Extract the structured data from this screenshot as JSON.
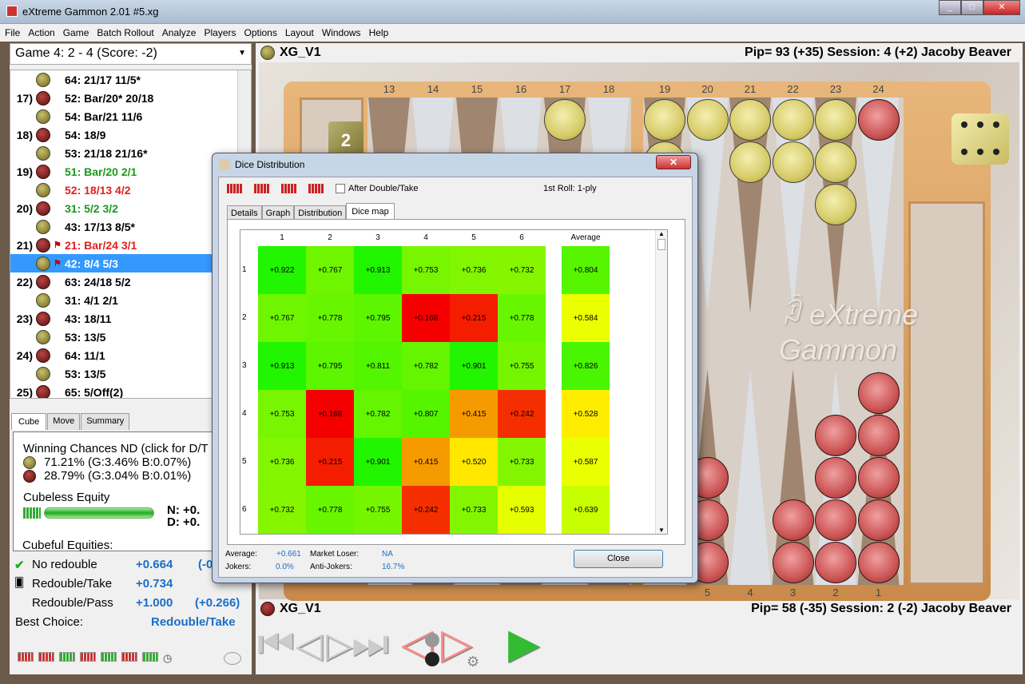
{
  "window": {
    "title": "eXtreme Gammon 2.01 #5.xg",
    "buttons": [
      "minimize",
      "maximize",
      "close"
    ]
  },
  "menu": [
    "File",
    "Action",
    "Game",
    "Batch Rollout",
    "Analyze",
    "Players",
    "Options",
    "Layout",
    "Windows",
    "Help"
  ],
  "game_select": "Game 4: 2 - 4 (Score: -2)",
  "moves": [
    {
      "num": "",
      "color": "yellow",
      "text": "64: 21/17 11/5*",
      "tc": "#000"
    },
    {
      "num": "17)",
      "color": "red",
      "text": "52: Bar/20* 20/18",
      "tc": "#000"
    },
    {
      "num": "",
      "color": "yellow",
      "text": "54: Bar/21 11/6",
      "tc": "#000"
    },
    {
      "num": "18)",
      "color": "red",
      "text": "54: 18/9",
      "tc": "#000"
    },
    {
      "num": "",
      "color": "yellow",
      "text": "53: 21/18 21/16*",
      "tc": "#000"
    },
    {
      "num": "19)",
      "color": "red",
      "text": "51: Bar/20 2/1",
      "tc": "#1a9a1a"
    },
    {
      "num": "",
      "color": "yellow",
      "text": "52: 18/13 4/2",
      "tc": "#e02020"
    },
    {
      "num": "20)",
      "color": "red",
      "text": "31: 5/2 3/2",
      "tc": "#1a9a1a"
    },
    {
      "num": "",
      "color": "yellow",
      "text": "43: 17/13 8/5*",
      "tc": "#000"
    },
    {
      "num": "21)",
      "color": "red",
      "flag": true,
      "text": "21: Bar/24 3/1",
      "tc": "#e02020"
    },
    {
      "num": "",
      "color": "yellow",
      "flag": true,
      "text": "42: 8/4 5/3",
      "tc": "#fff",
      "selected": true
    },
    {
      "num": "22)",
      "color": "red",
      "text": "63: 24/18 5/2",
      "tc": "#000"
    },
    {
      "num": "",
      "color": "yellow",
      "text": "31: 4/1 2/1",
      "tc": "#000"
    },
    {
      "num": "23)",
      "color": "red",
      "text": "43: 18/11",
      "tc": "#000"
    },
    {
      "num": "",
      "color": "yellow",
      "text": "53: 13/5",
      "tc": "#000"
    },
    {
      "num": "24)",
      "color": "red",
      "text": "64: 11/1",
      "tc": "#000"
    },
    {
      "num": "",
      "color": "yellow",
      "text": "53: 13/5",
      "tc": "#000"
    },
    {
      "num": "25)",
      "color": "red",
      "text": "65: 5/Off(2)",
      "tc": "#000"
    }
  ],
  "analysis_tabs": [
    "Cube",
    "Move",
    "Summary"
  ],
  "cube": {
    "winning_title": "Winning Chances ND (click for D/T",
    "yellow_line": "71.21% (G:3.46% B:0.07%)",
    "red_line": "28.79% (G:3.04% B:0.01%)",
    "cubeless_label": "Cubeless Equity",
    "n_value": "N: +0.",
    "d_value": "D: +0.",
    "cubeful_label": "Cubeful Equities:",
    "rows": [
      {
        "label": "No redouble",
        "eq": "+0.664",
        "diff": "(-0"
      },
      {
        "label": "Redouble/Take",
        "eq": "+0.734",
        "diff": ""
      },
      {
        "label": "Redouble/Pass",
        "eq": "+1.000",
        "diff": "(+0.266)"
      }
    ],
    "best_label": "Best Choice:",
    "best_value": "Redouble/Take"
  },
  "board": {
    "top_player": "XG_V1",
    "top_info": "Pip= 93 (+35)   Session: 4 (+2) Jacoby Beaver",
    "bottom_player": "XG_V1",
    "bottom_info": "Pip= 58 (-35)   Session: 2 (-2) Jacoby Beaver",
    "top_numbers": [
      "13",
      "14",
      "15",
      "16",
      "17",
      "18",
      "19",
      "20",
      "21",
      "22",
      "23",
      "24"
    ],
    "bottom_numbers": [
      "5",
      "4",
      "3",
      "2",
      "1"
    ],
    "cube_value": "2",
    "logo": "eXtreme Gammon",
    "points": [
      {
        "point": 17,
        "color": "yellow",
        "count": 1
      },
      {
        "point": 19,
        "color": "yellow",
        "count": 2
      },
      {
        "point": 20,
        "color": "yellow",
        "count": 1
      },
      {
        "point": 21,
        "color": "yellow",
        "count": 2
      },
      {
        "point": 22,
        "color": "yellow",
        "count": 2
      },
      {
        "point": 23,
        "color": "yellow",
        "count": 3
      },
      {
        "point": 24,
        "color": "red",
        "count": 1
      },
      {
        "point": 6,
        "color": "red",
        "count": 3
      },
      {
        "point": 5,
        "color": "red",
        "count": 3
      },
      {
        "point": 3,
        "color": "red",
        "count": 2
      },
      {
        "point": 2,
        "color": "red",
        "count": 4
      },
      {
        "point": 1,
        "color": "red",
        "count": 5
      }
    ]
  },
  "dialog": {
    "title": "Dice Distribution",
    "after_double_label": "After Double/Take",
    "first_roll": "1st Roll: 1-ply",
    "tabs": [
      "Details",
      "Graph",
      "Distribution",
      "Dice map"
    ],
    "active_tab": "Dice map",
    "columns": [
      "1",
      "2",
      "3",
      "4",
      "5",
      "6",
      "Average"
    ],
    "rows": [
      {
        "label": "1",
        "values": [
          "+0.922",
          "+0.767",
          "+0.913",
          "+0.753",
          "+0.736",
          "+0.732"
        ],
        "avg": "+0.804"
      },
      {
        "label": "2",
        "values": [
          "+0.767",
          "+0.778",
          "+0.795",
          "+0.168",
          "+0.215",
          "+0.778"
        ],
        "avg": "+0.584"
      },
      {
        "label": "3",
        "values": [
          "+0.913",
          "+0.795",
          "+0.811",
          "+0.782",
          "+0.901",
          "+0.755"
        ],
        "avg": "+0.826"
      },
      {
        "label": "4",
        "values": [
          "+0.753",
          "+0.168",
          "+0.782",
          "+0.807",
          "+0.415",
          "+0.242"
        ],
        "avg": "+0.528"
      },
      {
        "label": "5",
        "values": [
          "+0.736",
          "+0.215",
          "+0.901",
          "+0.415",
          "+0.520",
          "+0.733"
        ],
        "avg": "+0.587"
      },
      {
        "label": "6",
        "values": [
          "+0.732",
          "+0.778",
          "+0.755",
          "+0.242",
          "+0.733",
          "+0.593"
        ],
        "avg": "+0.639"
      }
    ],
    "footer": {
      "average_label": "Average:",
      "average": "+0.661",
      "market_loser_label": "Market Loser:",
      "market_loser": "NA",
      "jokers_label": "Jokers:",
      "jokers": "0.0%",
      "anti_jokers_label": "Anti-Jokers:",
      "anti_jokers": "16.7%"
    },
    "close_label": "Close"
  }
}
